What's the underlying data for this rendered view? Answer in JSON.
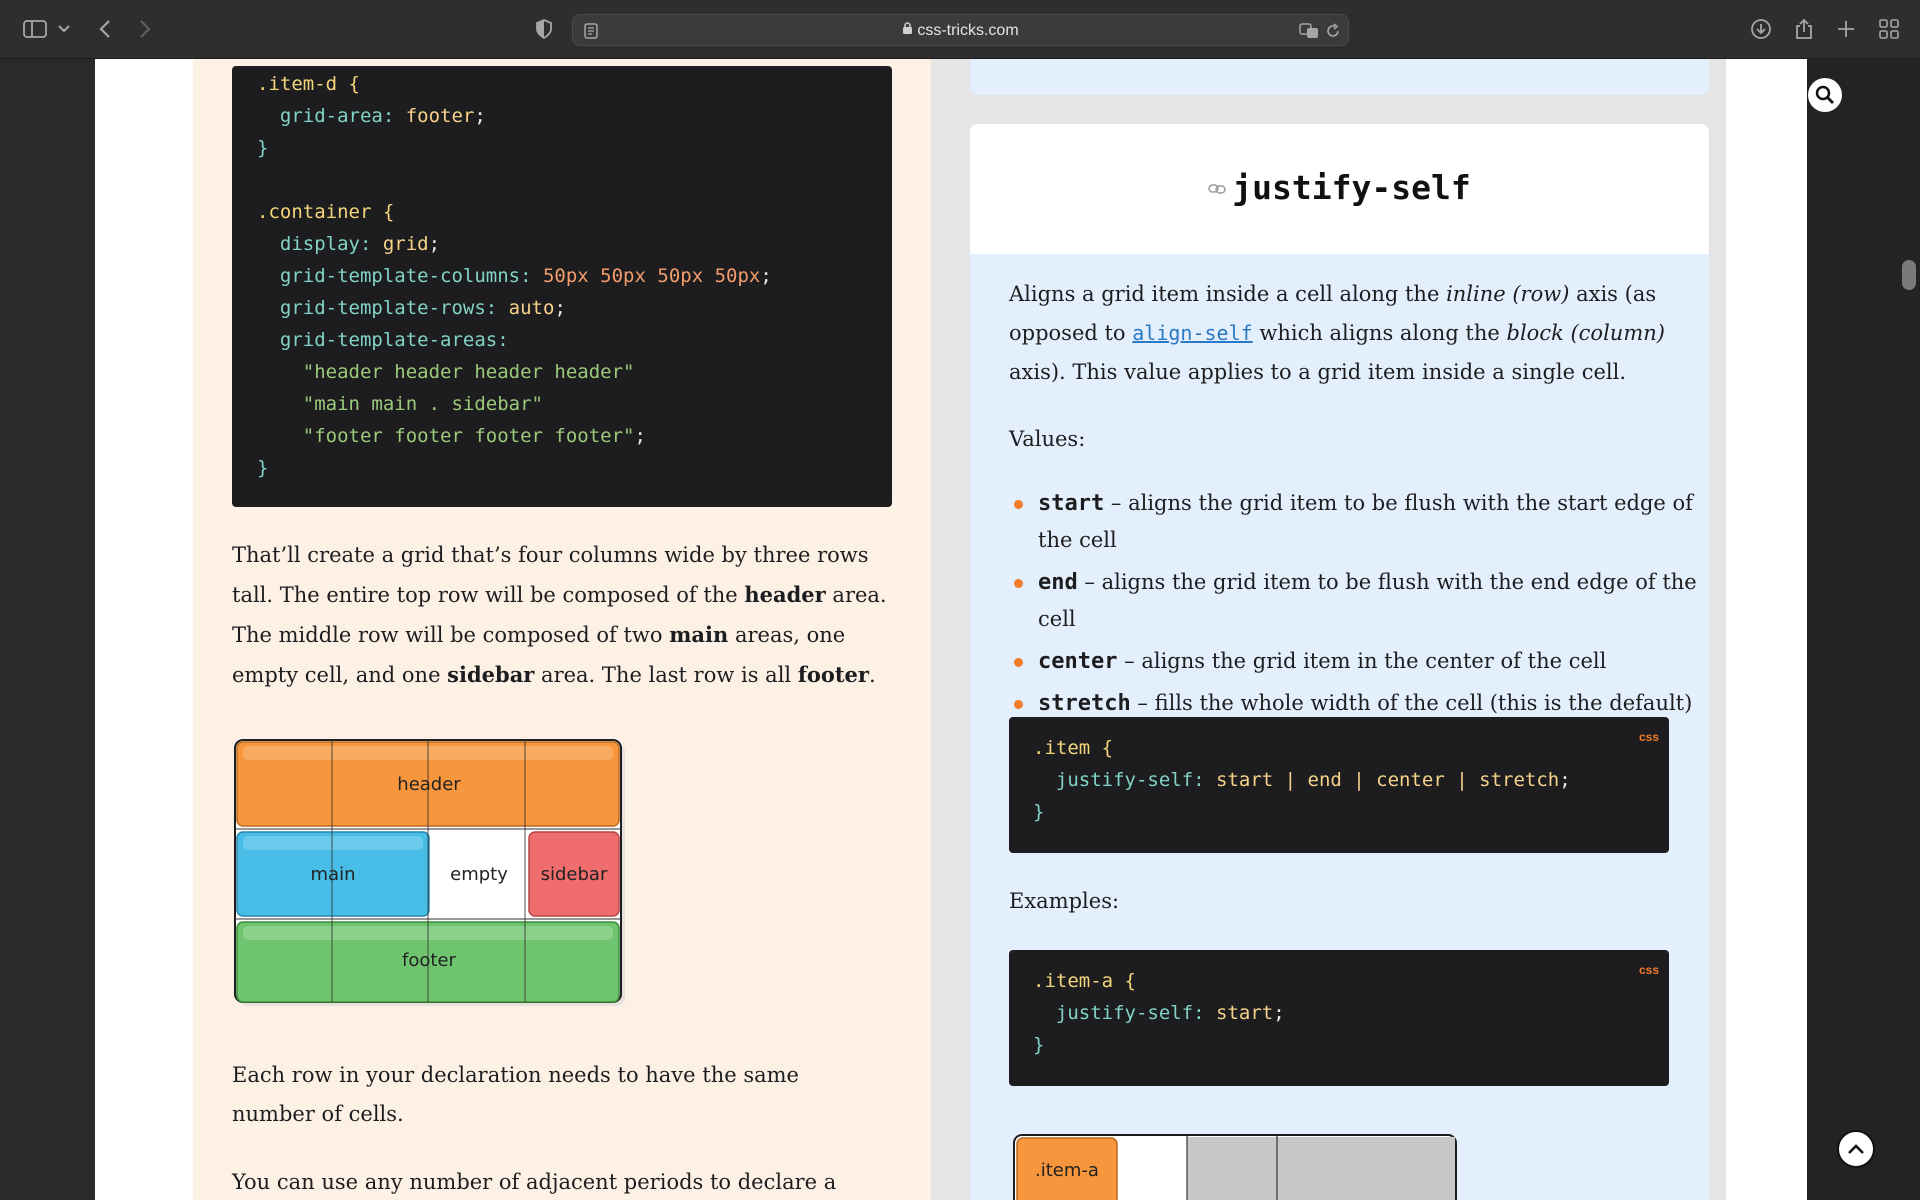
{
  "browser": {
    "url": "css-tricks.com"
  },
  "left_code": {
    "lines": [
      [
        [
          ".item-d {",
          "sel"
        ]
      ],
      [
        [
          "  grid-area: ",
          "prop"
        ],
        [
          "footer",
          "val"
        ],
        [
          ";",
          "punc"
        ]
      ],
      [
        [
          "}",
          "prop"
        ]
      ],
      [
        [
          "",
          "punc"
        ]
      ],
      [
        [
          ".container {",
          "sel"
        ]
      ],
      [
        [
          "  display: ",
          "prop"
        ],
        [
          "grid",
          "val"
        ],
        [
          ";",
          "punc"
        ]
      ],
      [
        [
          "  grid-template-columns: ",
          "prop"
        ],
        [
          "50px 50px 50px 50px",
          "num"
        ],
        [
          ";",
          "punc"
        ]
      ],
      [
        [
          "  grid-template-rows: ",
          "prop"
        ],
        [
          "auto",
          "val"
        ],
        [
          ";",
          "punc"
        ]
      ],
      [
        [
          "  grid-template-areas:",
          "prop"
        ]
      ],
      [
        [
          "    \"header header header header\"",
          "str"
        ]
      ],
      [
        [
          "    \"main main . sidebar\"",
          "str"
        ]
      ],
      [
        [
          "    \"footer footer footer footer\"",
          "str"
        ],
        [
          ";",
          "punc"
        ]
      ],
      [
        [
          "}",
          "prop"
        ]
      ]
    ]
  },
  "article": {
    "para1": [
      [
        "That’ll create a grid that’s four columns wide by three rows tall. The entire top row will be composed of the ",
        false
      ],
      [
        "header",
        true
      ],
      [
        " area. The middle row will be composed of two ",
        false
      ],
      [
        "main",
        true
      ],
      [
        " areas, one empty cell, and one ",
        false
      ],
      [
        "sidebar",
        true
      ],
      [
        " area. The last row is all ",
        false
      ],
      [
        "footer",
        true
      ],
      [
        ".",
        false
      ]
    ],
    "para2": "Each row in your declaration needs to have the same number of cells.",
    "para3": "You can use any number of adjacent periods to declare a single"
  },
  "diagram": {
    "header": "header",
    "main": "main",
    "empty": "empty",
    "sidebar": "sidebar",
    "footer": "footer",
    "colors": {
      "header": "#f7963c",
      "main": "#47bde8",
      "sidebar": "#ef6d6d",
      "footer": "#6fc56f"
    }
  },
  "card": {
    "title": "justify-self",
    "intro_parts": [
      [
        "Aligns a grid item inside a cell along the ",
        "text"
      ],
      [
        "inline (row)",
        "italic"
      ],
      [
        " axis (as opposed to ",
        "text"
      ],
      [
        "align-self",
        "link"
      ],
      [
        " which aligns along the ",
        "text"
      ],
      [
        "block (column)",
        "italic"
      ],
      [
        " axis). This value applies to a grid item inside a single cell.",
        "text"
      ]
    ],
    "values_heading": "Values:",
    "values": [
      {
        "kw": "start",
        "desc": " – aligns the grid item to be flush with the start edge of the cell"
      },
      {
        "kw": "end",
        "desc": " – aligns the grid item to be flush with the end edge of the cell"
      },
      {
        "kw": "center",
        "desc": " – aligns the grid item in the center of the cell"
      },
      {
        "kw": "stretch",
        "desc": " – fills the whole width of the cell (this is the default)"
      }
    ],
    "code1_tag": "css",
    "code1": [
      [
        [
          ".item {",
          "sel"
        ]
      ],
      [
        [
          "  justify-self: ",
          "prop"
        ],
        [
          "start | end | center | stretch",
          "val"
        ],
        [
          ";",
          "punc"
        ]
      ],
      [
        [
          "}",
          "prop"
        ]
      ]
    ],
    "examples_heading": "Examples:",
    "code2_tag": "css",
    "code2": [
      [
        [
          ".item-a {",
          "sel"
        ]
      ],
      [
        [
          "  justify-self: ",
          "prop"
        ],
        [
          "start",
          "val"
        ],
        [
          ";",
          "punc"
        ]
      ],
      [
        [
          "}",
          "prop"
        ]
      ]
    ],
    "example_label": ".item-a"
  }
}
